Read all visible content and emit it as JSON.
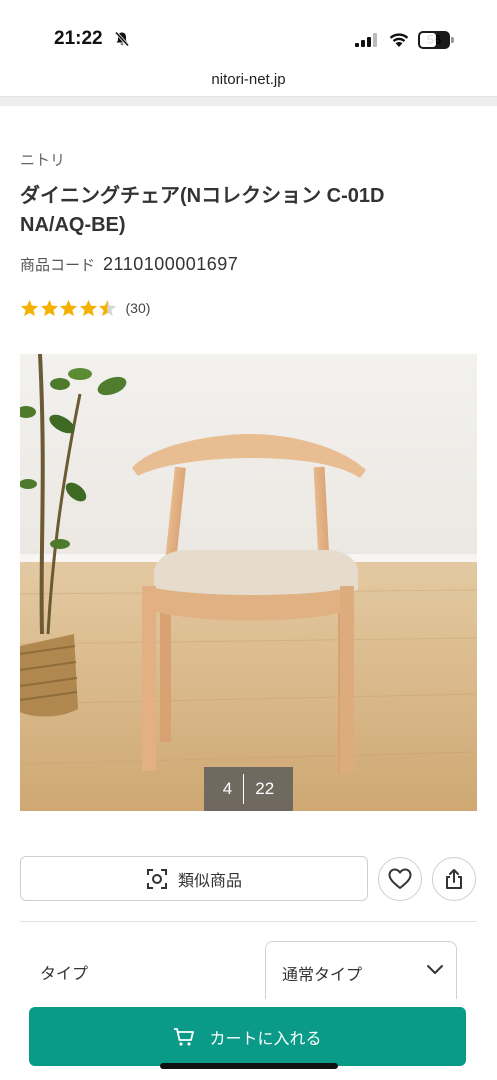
{
  "status_bar": {
    "time": "21:22",
    "battery_level": "56"
  },
  "browser": {
    "url": "nitori-net.jp"
  },
  "product": {
    "brand": "ニトリ",
    "title": "ダイニングチェア(Nコレクション C-01D NA/AQ-BE)",
    "code_label": "商品コード",
    "code_value": "2110100001697",
    "rating_value": 4.5,
    "rating_max": 5,
    "review_count": "(30)"
  },
  "gallery": {
    "current": "4",
    "total": "22"
  },
  "actions": {
    "similar_label": "類似商品"
  },
  "variant": {
    "label": "タイプ",
    "selected": "通常タイプ"
  },
  "cart": {
    "label": "カートに入れる"
  },
  "colors": {
    "accent": "#0a9b88",
    "star": "#f5b100"
  },
  "icons": [
    "bell-slash-icon",
    "signal-icon",
    "wifi-icon",
    "battery-icon",
    "camera-scan-icon",
    "heart-icon",
    "share-icon",
    "chevron-down-icon",
    "cart-icon",
    "star-icon"
  ]
}
